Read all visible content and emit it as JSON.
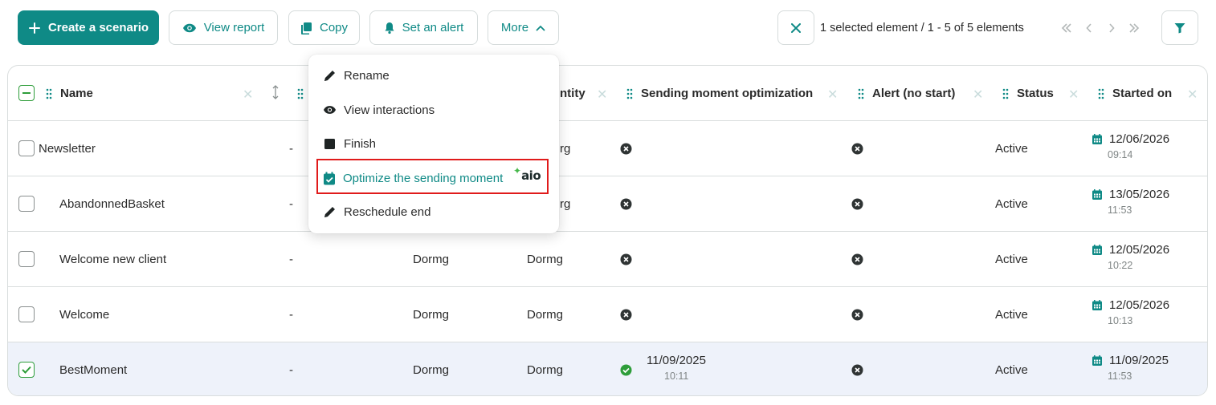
{
  "toolbar": {
    "create_label": "Create a scenario",
    "view_report_label": "View report",
    "copy_label": "Copy",
    "set_alert_label": "Set an alert",
    "more_label": "More",
    "selection_info": "1 selected element / 1 - 5 of 5 elements"
  },
  "colors": {
    "accent": "#0f8a86",
    "success": "#2e9d3a",
    "highlight": "#e01b1b",
    "selected_row": "#eef2fa"
  },
  "more_menu": {
    "items": [
      {
        "label": "Rename",
        "icon": "pencil-icon"
      },
      {
        "label": "View interactions",
        "icon": "eye-icon"
      },
      {
        "label": "Finish",
        "icon": "stop-icon"
      },
      {
        "label": "Optimize the sending moment",
        "icon": "calendar-check-icon",
        "badge": "aio"
      },
      {
        "label": "Reschedule end",
        "icon": "pencil-icon"
      }
    ]
  },
  "table": {
    "columns": {
      "name": "Name",
      "quantity_partial": "ntity",
      "sending_moment": "Sending moment optimization",
      "alert": "Alert (no start)",
      "status": "Status",
      "started_on": "Started on"
    },
    "rows": [
      {
        "name": "Newsletter",
        "col2": "-",
        "col3": "",
        "col4": "rg",
        "smo": "disabled",
        "alert": "disabled",
        "status": "Active",
        "date": "12/06/2026",
        "time": "09:14",
        "checked": false
      },
      {
        "name": "AbandonnedBasket",
        "col2": "-",
        "col3": "",
        "col4": "rg",
        "smo": "disabled",
        "alert": "disabled",
        "status": "Active",
        "date": "13/05/2026",
        "time": "11:53",
        "checked": false
      },
      {
        "name": "Welcome new client",
        "col2": "-",
        "col3": "Dormg",
        "col4": "Dormg",
        "smo": "disabled",
        "alert": "disabled",
        "status": "Active",
        "date": "12/05/2026",
        "time": "10:22",
        "checked": false
      },
      {
        "name": "Welcome",
        "col2": "-",
        "col3": "Dormg",
        "col4": "Dormg",
        "smo": "disabled",
        "alert": "disabled",
        "status": "Active",
        "date": "12/05/2026",
        "time": "10:13",
        "checked": false
      },
      {
        "name": "BestMoment",
        "col2": "-",
        "col3": "Dormg",
        "col4": "Dormg",
        "smo": "enabled",
        "smo_date": "11/09/2025",
        "smo_time": "10:11",
        "alert": "disabled",
        "status": "Active",
        "date": "11/09/2025",
        "time": "11:53",
        "checked": true
      }
    ]
  }
}
